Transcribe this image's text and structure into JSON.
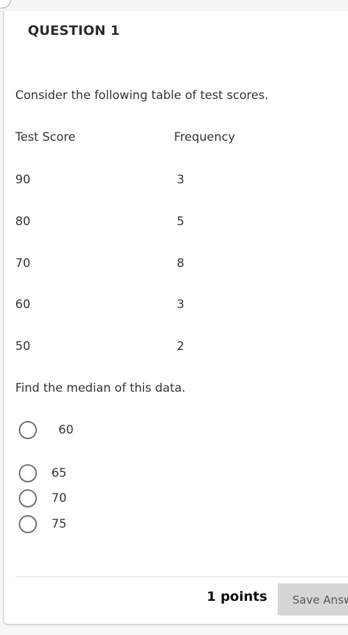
{
  "question": {
    "title": "QUESTION 1",
    "prompt": "Consider the following table of test scores.",
    "table": {
      "headers": [
        "Test Score",
        "Frequency"
      ],
      "rows": [
        {
          "score": "90",
          "frequency": "3"
        },
        {
          "score": "80",
          "frequency": "5"
        },
        {
          "score": "70",
          "frequency": "8"
        },
        {
          "score": "60",
          "frequency": "3"
        },
        {
          "score": "50",
          "frequency": "2"
        }
      ]
    },
    "instruction": "Find the median of this data.",
    "options": [
      {
        "label": "60",
        "selected": false
      },
      {
        "label": "65",
        "selected": false
      },
      {
        "label": "70",
        "selected": false
      },
      {
        "label": "75",
        "selected": false
      }
    ]
  },
  "footer": {
    "points": "1 points",
    "save_label": "Save Answer"
  },
  "colors": {
    "button_bg": "#d6d6d6",
    "text": "#333333",
    "radio_border": "#6e6e6e"
  }
}
